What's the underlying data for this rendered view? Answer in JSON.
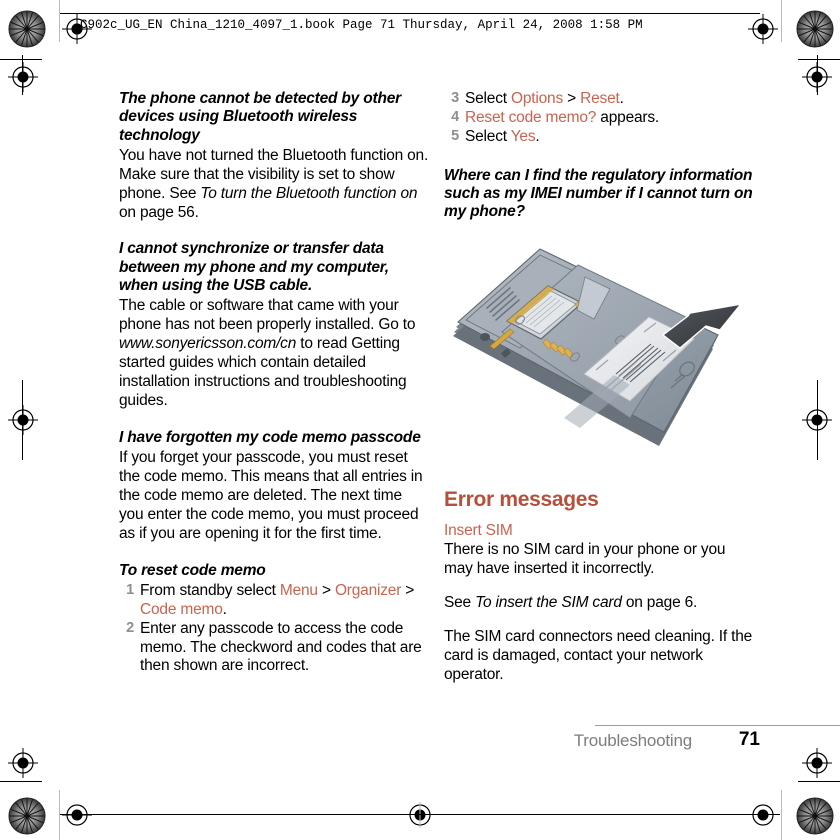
{
  "header": {
    "info_line": "C902c_UG_EN China_1210_4097_1.book  Page 71  Thursday, April 24, 2008  1:58 PM"
  },
  "colors": {
    "heading_accent": "#B4503C",
    "link_accent": "#C8644F",
    "step_number": "#8E8E8E",
    "footer_chapter": "#7D7D7D",
    "body_text": "#000000"
  },
  "left_column": {
    "block1": {
      "heading": "The phone cannot be detected by other devices using Bluetooth wireless technology",
      "body_part1": "You have not turned the Bluetooth function on. Make sure that the visibility is set to show phone. See ",
      "body_italic": "To turn the Bluetooth function on",
      "body_part2": " on page 56."
    },
    "block2": {
      "heading": "I cannot synchronize or transfer data between my phone and my computer, when using the USB cable.",
      "body_part1": "The cable or software that came with your phone has not been properly installed. Go to ",
      "body_italic": "www.sonyericsson.com/cn",
      "body_part2": " to read Getting started guides which contain detailed installation instructions and troubleshooting guides."
    },
    "block3": {
      "heading": "I have forgotten my code memo passcode",
      "body": "If you forget your passcode, you must reset the code memo. This means that all entries in the code memo are deleted. The next time you enter the code memo, you must proceed as if you are opening it for the first time."
    },
    "procedure": {
      "heading": "To reset code memo",
      "steps": [
        {
          "num": "1",
          "pre": "From standby select ",
          "link1": "Menu",
          "sep1": " > ",
          "link2": "Organizer",
          "sep2": " > ",
          "link3": "Code memo",
          "post": "."
        },
        {
          "num": "2",
          "text": "Enter any passcode to access the code memo. The checkword and codes that are then shown are incorrect."
        }
      ]
    }
  },
  "right_column": {
    "steps": [
      {
        "num": "3",
        "pre": "Select ",
        "link1": "Options",
        "sep1": " > ",
        "link2": "Reset",
        "post": "."
      },
      {
        "num": "4",
        "link1": "Reset code memo?",
        "post": " appears."
      },
      {
        "num": "5",
        "pre": "Select ",
        "link1": "Yes",
        "post": "."
      }
    ],
    "question_heading": "Where can I find the regulatory information such as my IMEI number if I cannot turn on my phone?",
    "figure": {
      "alt": "phone-back-cover-removed-sim-and-label-illustration"
    },
    "section_heading": "Error messages",
    "error": {
      "name": "Insert SIM",
      "para1": "There is no SIM card in your phone or you may have inserted it incorrectly.",
      "para2_pre": "See ",
      "para2_italic": "To insert the SIM card",
      "para2_post": " on page 6.",
      "para3": "The SIM card connectors need cleaning. If the card is damaged, contact your network operator."
    }
  },
  "footer": {
    "chapter": "Troubleshooting",
    "page_number": "71"
  }
}
